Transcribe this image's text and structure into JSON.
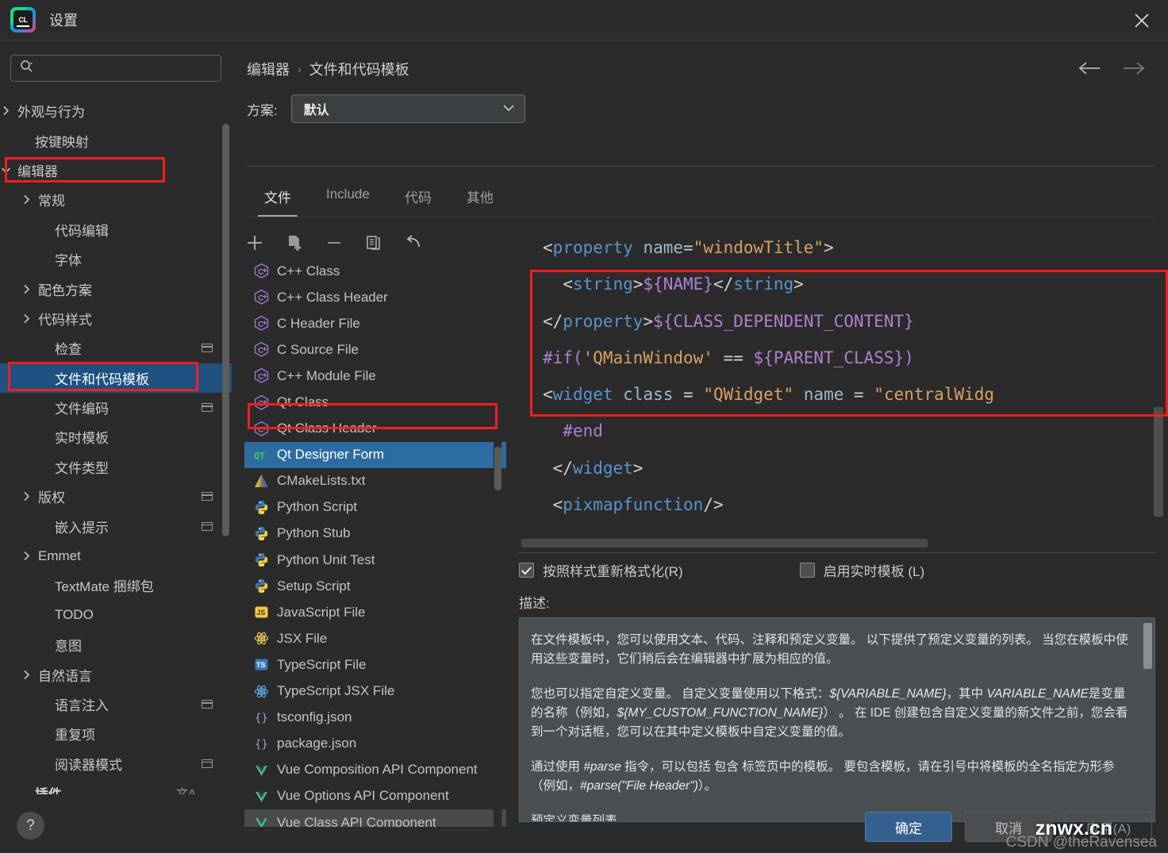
{
  "window": {
    "title": "设置",
    "logo_text": "CL",
    "close_label": "×"
  },
  "sidebar": {
    "search_placeholder": "",
    "search_value": "",
    "items": [
      {
        "label": "外观与行为",
        "chevron": "right",
        "indent": 22,
        "badge": false
      },
      {
        "label": "按键映射",
        "chevron": "none",
        "indent": 44,
        "badge": false
      },
      {
        "label": "编辑器",
        "chevron": "down",
        "indent": 22,
        "badge": false,
        "annotated": true
      },
      {
        "label": "常规",
        "chevron": "right",
        "indent": 48,
        "badge": false
      },
      {
        "label": "代码编辑",
        "chevron": "none",
        "indent": 69,
        "badge": false
      },
      {
        "label": "字体",
        "chevron": "none",
        "indent": 69,
        "badge": false
      },
      {
        "label": "配色方案",
        "chevron": "right",
        "indent": 48,
        "badge": false
      },
      {
        "label": "代码样式",
        "chevron": "right",
        "indent": 48,
        "badge": false
      },
      {
        "label": "检查",
        "chevron": "none",
        "indent": 69,
        "badge": true
      },
      {
        "label": "文件和代码模板",
        "chevron": "none",
        "indent": 69,
        "badge": false,
        "selected": true,
        "annotated": true
      },
      {
        "label": "文件编码",
        "chevron": "none",
        "indent": 69,
        "badge": true
      },
      {
        "label": "实时模板",
        "chevron": "none",
        "indent": 69,
        "badge": false
      },
      {
        "label": "文件类型",
        "chevron": "none",
        "indent": 69,
        "badge": false
      },
      {
        "label": "版权",
        "chevron": "right",
        "indent": 48,
        "badge": true
      },
      {
        "label": "嵌入提示",
        "chevron": "none",
        "indent": 69,
        "badge": true
      },
      {
        "label": "Emmet",
        "chevron": "right",
        "indent": 48,
        "badge": false
      },
      {
        "label": "TextMate 捆绑包",
        "chevron": "none",
        "indent": 69,
        "badge": false
      },
      {
        "label": "TODO",
        "chevron": "none",
        "indent": 69,
        "badge": false
      },
      {
        "label": "意图",
        "chevron": "none",
        "indent": 69,
        "badge": false
      },
      {
        "label": "自然语言",
        "chevron": "right",
        "indent": 48,
        "badge": false
      },
      {
        "label": "语言注入",
        "chevron": "none",
        "indent": 69,
        "badge": true
      },
      {
        "label": "重复项",
        "chevron": "none",
        "indent": 69,
        "badge": false
      },
      {
        "label": "阅读器模式",
        "chevron": "none",
        "indent": 69,
        "badge": true
      },
      {
        "label": "插件",
        "chevron": "none",
        "indent": 44,
        "badge": false,
        "bold": true,
        "lang": "文A"
      }
    ],
    "help_label": "?"
  },
  "header": {
    "breadcrumb": [
      "编辑器",
      "文件和代码模板"
    ],
    "separator": "›",
    "scheme_label": "方案:",
    "scheme_value": "默认"
  },
  "tabs": [
    {
      "label": "文件",
      "active": true
    },
    {
      "label": "Include",
      "active": false
    },
    {
      "label": "代码",
      "active": false
    },
    {
      "label": "其他",
      "active": false
    }
  ],
  "template_toolbar": [
    {
      "name": "add-icon",
      "label": "+"
    },
    {
      "name": "copy-template-icon",
      "label": ""
    },
    {
      "name": "remove-icon",
      "label": "−"
    },
    {
      "name": "duplicate-icon",
      "label": ""
    },
    {
      "name": "reset-icon",
      "label": ""
    }
  ],
  "template_list": [
    {
      "label": "C++ Class",
      "icon": "cpp-class-icon"
    },
    {
      "label": "C++ Class Header",
      "icon": "cpp-class-icon"
    },
    {
      "label": "C Header File",
      "icon": "cpp-class-icon"
    },
    {
      "label": "C Source File",
      "icon": "cpp-class-icon"
    },
    {
      "label": "C++ Module File",
      "icon": "cpp-class-icon"
    },
    {
      "label": "Qt Class",
      "icon": "cpp-class-icon"
    },
    {
      "label": "Qt Class Header",
      "icon": "cpp-class-icon"
    },
    {
      "label": "Qt Designer Form",
      "icon": "qt-icon",
      "selected": true,
      "annotated": true
    },
    {
      "label": "CMakeLists.txt",
      "icon": "cmake-icon"
    },
    {
      "label": "Python Script",
      "icon": "python-icon"
    },
    {
      "label": "Python Stub",
      "icon": "python-icon"
    },
    {
      "label": "Python Unit Test",
      "icon": "python-icon"
    },
    {
      "label": "Setup Script",
      "icon": "python-icon"
    },
    {
      "label": "JavaScript File",
      "icon": "js-icon"
    },
    {
      "label": "JSX File",
      "icon": "react-icon"
    },
    {
      "label": "TypeScript File",
      "icon": "ts-icon"
    },
    {
      "label": "TypeScript JSX File",
      "icon": "react-ts-icon"
    },
    {
      "label": "tsconfig.json",
      "icon": "json-icon"
    },
    {
      "label": "package.json",
      "icon": "json-icon"
    },
    {
      "label": "Vue Composition API Component",
      "icon": "vue-icon"
    },
    {
      "label": "Vue Options API Component",
      "icon": "vue-icon"
    },
    {
      "label": "Vue Class API Component",
      "icon": "vue-icon",
      "hovered": true
    }
  ],
  "editor": {
    "lines": [
      [
        {
          "t": "<",
          "c": "punct"
        },
        {
          "t": "property",
          "c": "tag"
        },
        {
          "t": " ",
          "c": "punct"
        },
        {
          "t": "name",
          "c": "attr"
        },
        {
          "t": "=",
          "c": "punct"
        },
        {
          "t": "\"windowTitle\"",
          "c": "str"
        },
        {
          "t": ">",
          "c": "punct"
        }
      ],
      [
        {
          "t": "  <",
          "c": "punct"
        },
        {
          "t": "string",
          "c": "tag"
        },
        {
          "t": ">",
          "c": "punct"
        },
        {
          "t": "${NAME}",
          "c": "var"
        },
        {
          "t": "</",
          "c": "punct"
        },
        {
          "t": "string",
          "c": "tag"
        },
        {
          "t": ">",
          "c": "punct"
        }
      ],
      [
        {
          "t": "</",
          "c": "punct"
        },
        {
          "t": "property",
          "c": "tag"
        },
        {
          "t": ">",
          "c": "punct"
        },
        {
          "t": "${CLASS_DEPENDENT_CONTENT}",
          "c": "var"
        }
      ],
      [
        {
          "t": "#if(",
          "c": "dir"
        },
        {
          "t": "'QMainWindow'",
          "c": "str"
        },
        {
          "t": " == ",
          "c": "punct"
        },
        {
          "t": "${PARENT_CLASS}",
          "c": "var"
        },
        {
          "t": ")",
          "c": "dir"
        }
      ],
      [
        {
          "t": "<",
          "c": "punct"
        },
        {
          "t": "widget",
          "c": "tag"
        },
        {
          "t": " ",
          "c": "punct"
        },
        {
          "t": "class",
          "c": "attr"
        },
        {
          "t": " = ",
          "c": "punct"
        },
        {
          "t": "\"QWidget\"",
          "c": "str"
        },
        {
          "t": " ",
          "c": "punct"
        },
        {
          "t": "name",
          "c": "attr"
        },
        {
          "t": " = ",
          "c": "punct"
        },
        {
          "t": "\"centralWidg",
          "c": "str"
        }
      ],
      [
        {
          "t": "  #end",
          "c": "dir"
        }
      ],
      [
        {
          "t": " </",
          "c": "punct"
        },
        {
          "t": "widget",
          "c": "tag"
        },
        {
          "t": ">",
          "c": "punct"
        }
      ],
      [
        {
          "t": " <",
          "c": "punct"
        },
        {
          "t": "pixmapfunction",
          "c": "tag"
        },
        {
          "t": "/>",
          "c": "punct"
        }
      ]
    ]
  },
  "options": {
    "reformat": {
      "label": "按照样式重新格式化(R)",
      "checked": true
    },
    "live_template": {
      "label": "启用实时模板 (L)",
      "checked": false
    }
  },
  "description": {
    "label": "描述:",
    "paragraphs": [
      "在文件模板中，您可以使用文本、代码、注释和预定义变量。 以下提供了预定义变量的列表。 当您在模板中使用这些变量时，它们稍后会在编辑器中扩展为相应的值。",
      "您也可以指定自定义变量。 自定义变量使用以下格式：${VARIABLE_NAME}，其中 VARIABLE_NAME是变量的名称（例如，${MY_CUSTOM_FUNCTION_NAME}） 。 在 IDE 创建包含自定义变量的新文件之前，您会看到一个对话框，您可以在其中定义模板中自定义变量的值。",
      "通过使用 #parse 指令，可以包括 包含 标签页中的模板。 要包含模板，请在引号中将模板的全名指定为形参（例如，#parse(\"File Header\")）。",
      "预定义变量列表"
    ]
  },
  "buttons": {
    "ok": "确定",
    "cancel": "取消",
    "apply": "应用(A)"
  },
  "watermark": {
    "text": "CSDN @theRavensea",
    "brand": "znwx.cn"
  },
  "colors": {
    "accent_selection": "#2d6ca2",
    "sidebar_selection": "#1e5180",
    "annotation_red": "#f21f1f",
    "primary_button": "#36618f",
    "background": "#2b2b2b",
    "description_bg": "#494f52"
  }
}
